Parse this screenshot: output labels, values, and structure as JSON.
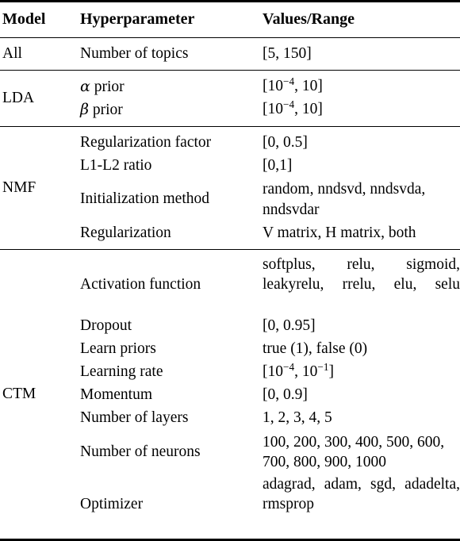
{
  "table": {
    "headers": {
      "model": "Model",
      "hyperparameter": "Hyperparameter",
      "values": "Values/Range"
    },
    "sections": [
      {
        "model": "All",
        "rows": [
          {
            "param": "Number of topics",
            "value": "[5, 150]"
          }
        ]
      },
      {
        "model": "LDA",
        "rows": [
          {
            "param": "α prior",
            "param_greek": "α",
            "param_rest": " prior",
            "value": "[10−4, 10]",
            "value_math": true,
            "mantissa": "[10",
            "exp1": "−4",
            "mid": ", 10]",
            "exp2": ""
          },
          {
            "param": "β prior",
            "param_greek": "β",
            "param_rest": " prior",
            "value": "[10−4, 10]",
            "value_math": true,
            "mantissa": "[10",
            "exp1": "−4",
            "mid": ", 10]",
            "exp2": ""
          }
        ]
      },
      {
        "model": "NMF",
        "rows": [
          {
            "param": "Regularization factor",
            "value": "[0, 0.5]"
          },
          {
            "param": "L1-L2 ratio",
            "value": "[0,1]"
          },
          {
            "param": "Initialization method",
            "value": "random, nndsvd, nndsvda, nndsvdar"
          },
          {
            "param": "Regularization",
            "value": "V matrix, H matrix, both"
          }
        ]
      },
      {
        "model": "CTM",
        "rows": [
          {
            "param": "Activation function",
            "value": "softplus, relu, sigmoid, leakyrelu, rrelu, elu, selu"
          },
          {
            "param": "Dropout",
            "value": "[0, 0.95]"
          },
          {
            "param": "Learn priors",
            "value": "true (1), false (0)"
          },
          {
            "param": "Learning rate",
            "value": "[10−4, 10−1]"
          },
          {
            "param": "Momentum",
            "value": "[0, 0.9]"
          },
          {
            "param": "Number of layers",
            "value": "1, 2, 3, 4, 5"
          },
          {
            "param": "Number of neurons",
            "value": "100, 200, 300, 400, 500, 600, 700, 800, 900, 1000"
          },
          {
            "param": "Optimizer",
            "value": "adagrad, adam, sgd, adadelta, rmsprop"
          }
        ]
      }
    ]
  },
  "math_fragments": {
    "lda_alpha_value_pre": "[10",
    "lda_alpha_value_exp": "−4",
    "lda_alpha_value_post": ", 10]",
    "lr_pre": "[10",
    "lr_exp1": "−4",
    "lr_mid": ", 10",
    "lr_exp2": "−1",
    "lr_post": "]"
  }
}
